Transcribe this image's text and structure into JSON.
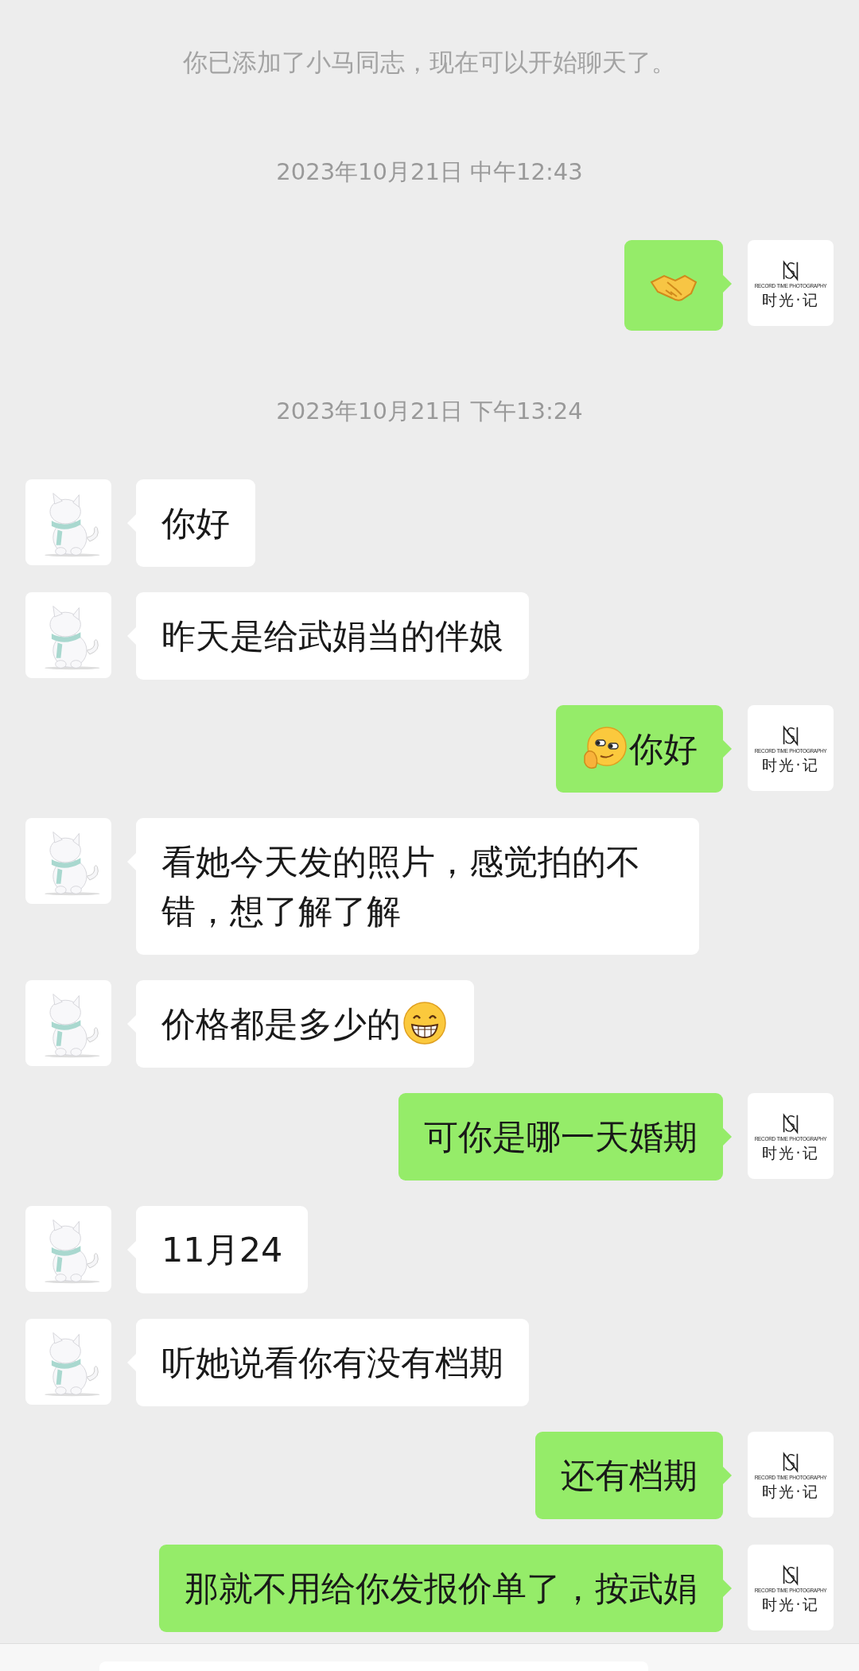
{
  "chat": [
    {
      "kind": "system",
      "text": "你已添加了小马同志，现在可以开始聊天了。"
    },
    {
      "kind": "time",
      "text": "2023年10月21日 中午12:43"
    },
    {
      "kind": "message",
      "outgoing": true,
      "parts": [
        {
          "kind": "handshake"
        }
      ],
      "avatar": {
        "caption": "RECORD TIME PHOTOGRAPHY",
        "name": "时光·记"
      }
    },
    {
      "kind": "time",
      "text": "2023年10月21日 下午13:24"
    },
    {
      "kind": "message",
      "outgoing": false,
      "parts": [
        {
          "kind": "text",
          "text": "你好"
        }
      ]
    },
    {
      "kind": "message",
      "outgoing": false,
      "parts": [
        {
          "kind": "text",
          "text": "昨天是给武娟当的伴娘"
        }
      ]
    },
    {
      "kind": "message",
      "outgoing": true,
      "parts": [
        {
          "kind": "smirk"
        },
        {
          "kind": "text",
          "text": "你好"
        }
      ],
      "avatar": {
        "caption": "RECORD TIME PHOTOGRAPHY",
        "name": "时光·记"
      }
    },
    {
      "kind": "message",
      "outgoing": false,
      "parts": [
        {
          "kind": "text",
          "text": "看她今天发的照片，感觉拍的不错，想了解了解"
        }
      ]
    },
    {
      "kind": "message",
      "outgoing": false,
      "parts": [
        {
          "kind": "text",
          "text": "价格都是多少的"
        },
        {
          "kind": "grin"
        }
      ]
    },
    {
      "kind": "message",
      "outgoing": true,
      "parts": [
        {
          "kind": "text",
          "text": "可你是哪一天婚期"
        }
      ],
      "avatar": {
        "caption": "RECORD TIME PHOTOGRAPHY",
        "name": "时光·记"
      }
    },
    {
      "kind": "message",
      "outgoing": false,
      "parts": [
        {
          "kind": "text",
          "text": "11月24"
        }
      ]
    },
    {
      "kind": "message",
      "outgoing": false,
      "parts": [
        {
          "kind": "text",
          "text": "听她说看你有没有档期"
        }
      ]
    },
    {
      "kind": "message",
      "outgoing": true,
      "parts": [
        {
          "kind": "text",
          "text": "还有档期"
        }
      ],
      "avatar": {
        "caption": "RECORD TIME PHOTOGRAPHY",
        "name": "时光·记"
      }
    },
    {
      "kind": "message",
      "outgoing": true,
      "parts": [
        {
          "kind": "text",
          "text": "那就不用给你发报价单了，按武娟"
        }
      ],
      "avatar": {
        "caption": "RECORD TIME PHOTOGRAPHY",
        "name": "时光·记"
      }
    }
  ],
  "input": {
    "kind": "bar"
  }
}
